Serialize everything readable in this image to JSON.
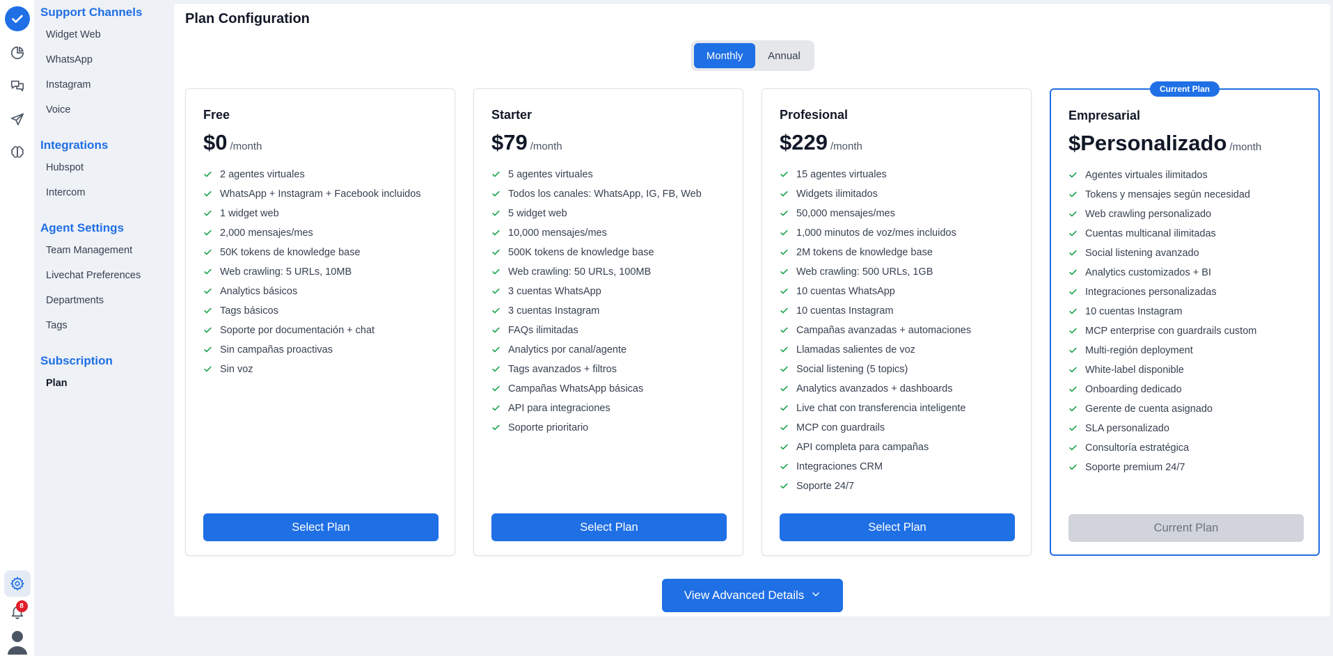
{
  "colors": {
    "accent": "#1f6fe5",
    "check": "#16a34a",
    "badge": "#e11d2a",
    "sidebar_title": "#1f6fe5"
  },
  "rail": {
    "icons": [
      "check-circle-logo-icon",
      "pie-chart-icon",
      "chat-bubbles-icon",
      "send-icon",
      "brain-icon"
    ],
    "bottom_icons": [
      "gear-icon",
      "bell-icon",
      "user-avatar-icon"
    ],
    "notification_count": "8"
  },
  "sidebar": {
    "sections": [
      {
        "title": "Support Channels",
        "items": [
          "Widget Web",
          "WhatsApp",
          "Instagram",
          "Voice"
        ]
      },
      {
        "title": "Integrations",
        "items": [
          "Hubspot",
          "Intercom"
        ]
      },
      {
        "title": "Agent Settings",
        "items": [
          "Team Management",
          "Livechat Preferences",
          "Departments",
          "Tags"
        ]
      },
      {
        "title": "Subscription",
        "items": [
          "Plan"
        ]
      }
    ],
    "active_item": "Plan"
  },
  "main": {
    "title": "Plan Configuration",
    "billing_toggle": {
      "monthly": "Monthly",
      "annual": "Annual",
      "selected": "Monthly"
    },
    "plans": [
      {
        "name": "Free",
        "price": "$0",
        "period": "/month",
        "current": false,
        "button": "Select Plan",
        "features": [
          "2 agentes virtuales",
          "WhatsApp + Instagram + Facebook incluidos",
          "1 widget web",
          "2,000 mensajes/mes",
          "50K tokens de knowledge base",
          "Web crawling: 5 URLs, 10MB",
          "Analytics básicos",
          "Tags básicos",
          "Soporte por documentación + chat",
          "Sin campañas proactivas",
          "Sin voz"
        ]
      },
      {
        "name": "Starter",
        "price": "$79",
        "period": "/month",
        "current": false,
        "button": "Select Plan",
        "features": [
          "5 agentes virtuales",
          "Todos los canales: WhatsApp, IG, FB, Web",
          "5 widget web",
          "10,000 mensajes/mes",
          "500K tokens de knowledge base",
          "Web crawling: 50 URLs, 100MB",
          "3 cuentas WhatsApp",
          "3 cuentas Instagram",
          "FAQs ilimitadas",
          "Analytics por canal/agente",
          "Tags avanzados + filtros",
          "Campañas WhatsApp básicas",
          "API para integraciones",
          "Soporte prioritario"
        ]
      },
      {
        "name": "Profesional",
        "price": "$229",
        "period": "/month",
        "current": false,
        "button": "Select Plan",
        "features": [
          "15 agentes virtuales",
          "Widgets ilimitados",
          "50,000 mensajes/mes",
          "1,000 minutos de voz/mes incluidos",
          "2M tokens de knowledge base",
          "Web crawling: 500 URLs, 1GB",
          "10 cuentas WhatsApp",
          "10 cuentas Instagram",
          "Campañas avanzadas + automaciones",
          "Llamadas salientes de voz",
          "Social listening (5 topics)",
          "Analytics avanzados + dashboards",
          "Live chat con transferencia inteligente",
          "MCP con guardrails",
          "API completa para campañas",
          "Integraciones CRM",
          "Soporte 24/7"
        ]
      },
      {
        "name": "Empresarial",
        "price": "$Personalizado",
        "period": "/month",
        "current": true,
        "tag": "Current Plan",
        "button": "Current Plan",
        "features": [
          "Agentes virtuales ilimitados",
          "Tokens y mensajes según necesidad",
          "Web crawling personalizado",
          "Cuentas multicanal ilimitadas",
          "Social listening avanzado",
          "Analytics customizados + BI",
          "Integraciones personalizadas",
          "10 cuentas Instagram",
          "MCP enterprise con guardrails custom",
          "Multi-región deployment",
          "White-label disponible",
          "Onboarding dedicado",
          "Gerente de cuenta asignado",
          "SLA personalizado",
          "Consultoría estratégica",
          "Soporte premium 24/7"
        ]
      }
    ],
    "advanced_button": "View Advanced Details"
  }
}
